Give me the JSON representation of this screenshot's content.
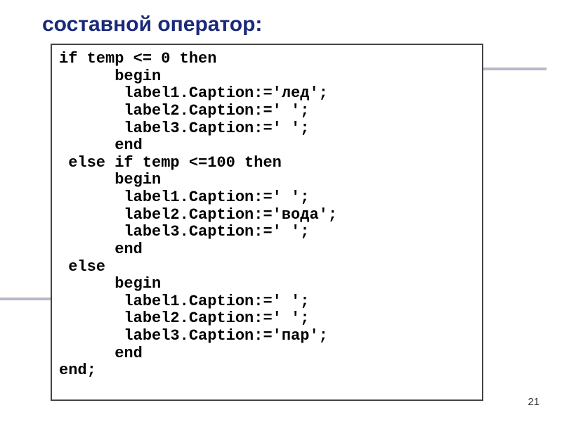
{
  "title": "составной оператор:",
  "page_number": "21",
  "code_lines": [
    "if temp <= 0 then",
    "      begin",
    "       label1.Caption:='лед';",
    "       label2.Caption:=' ';",
    "       label3.Caption:=' ';",
    "      end",
    " else if temp <=100 then",
    "      begin",
    "       label1.Caption:=' ';",
    "       label2.Caption:='вода';",
    "       label3.Caption:=' ';",
    "      end",
    " else",
    "      begin",
    "       label1.Caption:=' ';",
    "       label2.Caption:=' ';",
    "       label3.Caption:='пар';",
    "      end",
    "end;"
  ]
}
